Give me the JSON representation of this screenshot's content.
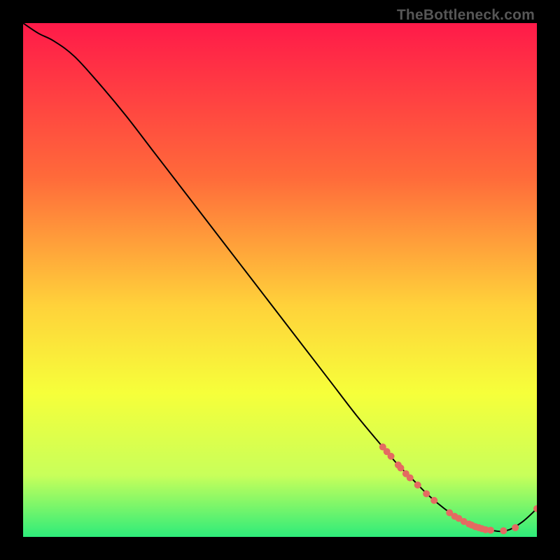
{
  "watermark": "TheBottleneck.com",
  "colors": {
    "bg": "#000000",
    "grad_top": "#ff1a49",
    "grad_mid1": "#ff6a3a",
    "grad_mid2": "#ffd23a",
    "grad_mid3": "#f6ff3a",
    "grad_mid4": "#c8ff5a",
    "grad_bottom": "#2eec7a",
    "curve": "#000000",
    "marker": "#e46a61"
  },
  "chart_data": {
    "type": "line",
    "title": "",
    "xlabel": "",
    "ylabel": "",
    "xlim": [
      0,
      100
    ],
    "ylim": [
      0,
      100
    ],
    "grid": false,
    "legend": false,
    "annotations": [],
    "series": [
      {
        "name": "curve",
        "x": [
          0,
          3,
          6,
          10,
          15,
          20,
          25,
          30,
          35,
          40,
          45,
          50,
          55,
          60,
          65,
          70,
          73,
          76,
          79,
          82,
          85,
          88,
          91,
          94,
          97,
          100
        ],
        "y": [
          100,
          98,
          96.5,
          93.5,
          88,
          82,
          75.5,
          69,
          62.5,
          56,
          49.5,
          43,
          36.5,
          30,
          23.5,
          17.5,
          14,
          11,
          8,
          5.5,
          3.5,
          2,
          1.3,
          1.2,
          2.8,
          5.5
        ]
      }
    ],
    "markers": [
      {
        "x": 70.0,
        "y": 17.5
      },
      {
        "x": 70.8,
        "y": 16.6
      },
      {
        "x": 71.6,
        "y": 15.7
      },
      {
        "x": 73.0,
        "y": 14.0
      },
      {
        "x": 73.5,
        "y": 13.4
      },
      {
        "x": 74.5,
        "y": 12.3
      },
      {
        "x": 75.3,
        "y": 11.5
      },
      {
        "x": 76.8,
        "y": 10.1
      },
      {
        "x": 78.5,
        "y": 8.4
      },
      {
        "x": 80.0,
        "y": 7.1
      },
      {
        "x": 83.0,
        "y": 4.7
      },
      {
        "x": 84.0,
        "y": 4.0
      },
      {
        "x": 84.8,
        "y": 3.6
      },
      {
        "x": 85.8,
        "y": 3.0
      },
      {
        "x": 86.8,
        "y": 2.5
      },
      {
        "x": 87.3,
        "y": 2.3
      },
      {
        "x": 88.0,
        "y": 2.0
      },
      {
        "x": 88.7,
        "y": 1.8
      },
      {
        "x": 89.3,
        "y": 1.6
      },
      {
        "x": 90.0,
        "y": 1.4
      },
      {
        "x": 91.0,
        "y": 1.3
      },
      {
        "x": 93.5,
        "y": 1.2
      },
      {
        "x": 95.8,
        "y": 1.8
      },
      {
        "x": 100.0,
        "y": 5.5
      }
    ]
  }
}
